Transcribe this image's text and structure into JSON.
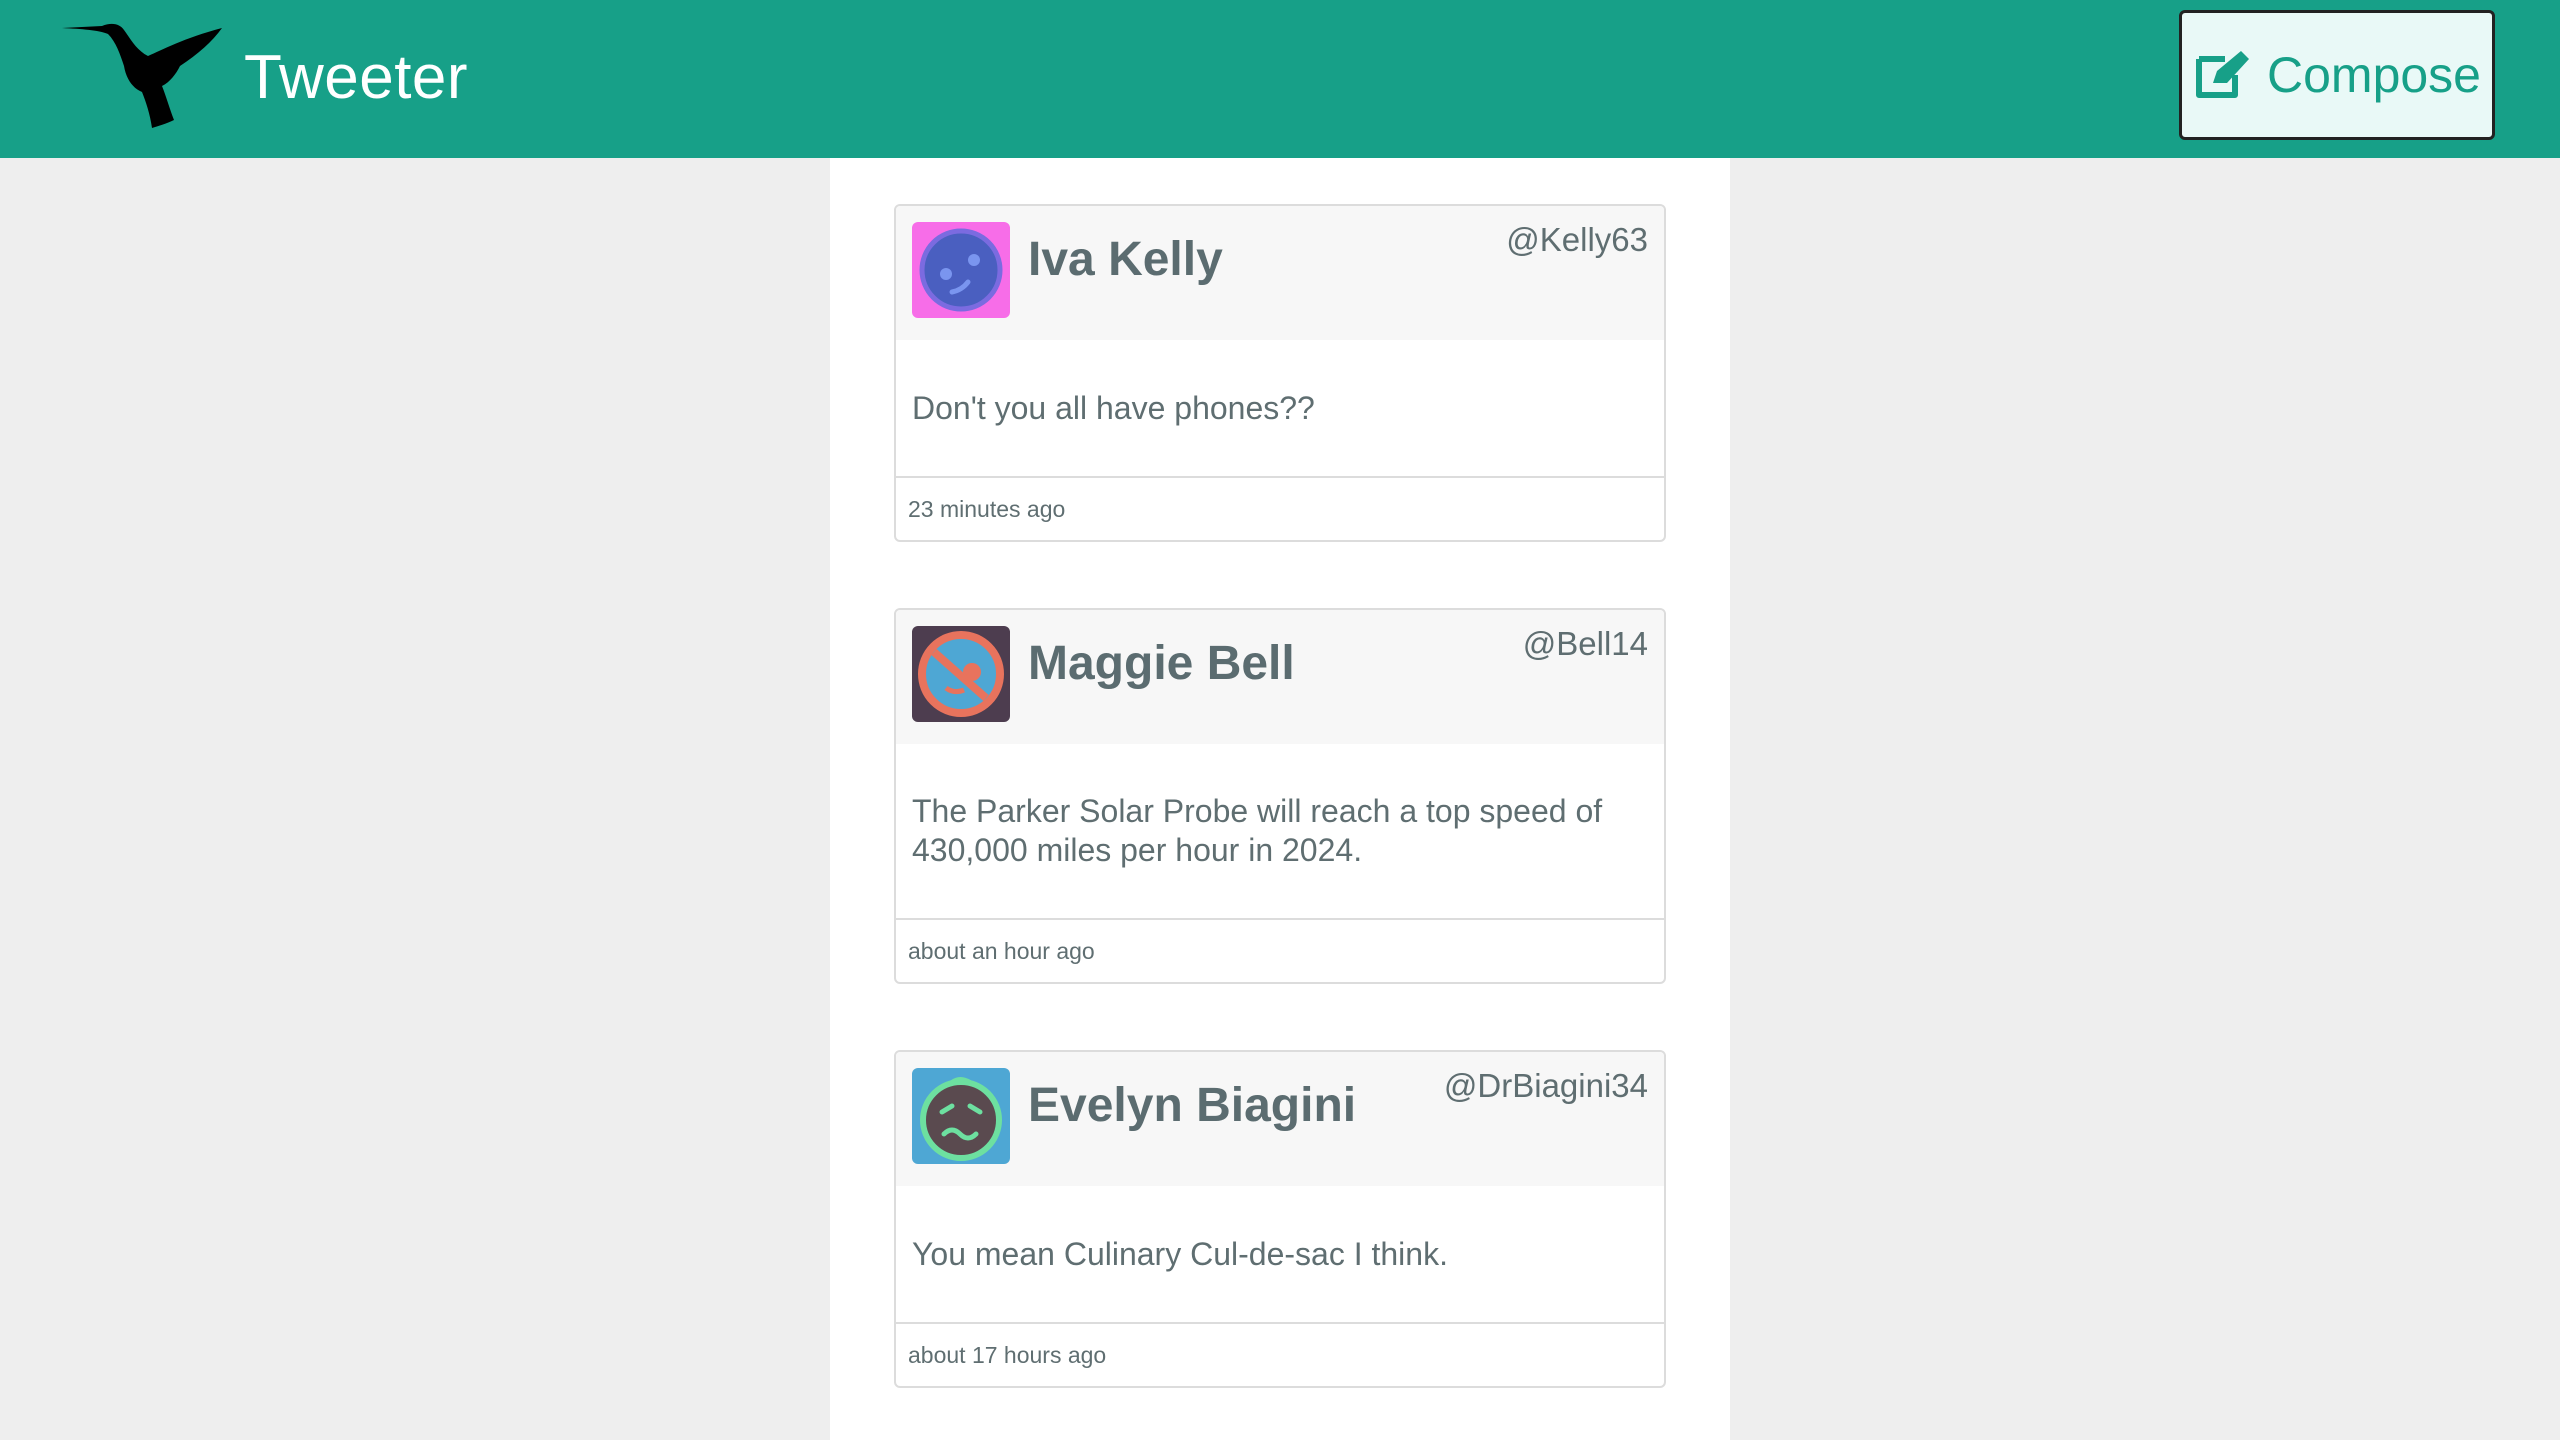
{
  "nav": {
    "brand": "Tweeter",
    "compose_label": "Compose",
    "logo_icon": "hummingbird-icon",
    "compose_icon": "edit-icon"
  },
  "colors": {
    "nav_bg": "#17a088",
    "page_bg": "#eeeeee",
    "card_bg": "#ffffff",
    "card_header_bg": "#f7f7f7",
    "compose_bg": "#e9f9f7",
    "text": "#5f6e71"
  },
  "tweets": [
    {
      "name": "Iva Kelly",
      "handle": "@Kelly63",
      "text": "Don't you all have phones??",
      "time": "23 minutes ago",
      "avatar": {
        "bg": "#f76de8",
        "face": "#4a5fc0"
      }
    },
    {
      "name": "Maggie Bell",
      "handle": "@Bell14",
      "text": "The Parker Solar Probe will reach a top speed of 430,000 miles per hour in 2024.",
      "time": "about an hour ago",
      "avatar": {
        "bg": "#4d3d4f",
        "face": "#4ea7d4",
        "ring": "#e8735d"
      }
    },
    {
      "name": "Evelyn Biagini",
      "handle": "@DrBiagini34",
      "text": "You mean Culinary Cul-de-sac I think.",
      "time": "about 17 hours ago",
      "avatar": {
        "bg": "#4ea7d4",
        "face": "#5a4a4f",
        "ring": "#6de0a0"
      }
    }
  ]
}
